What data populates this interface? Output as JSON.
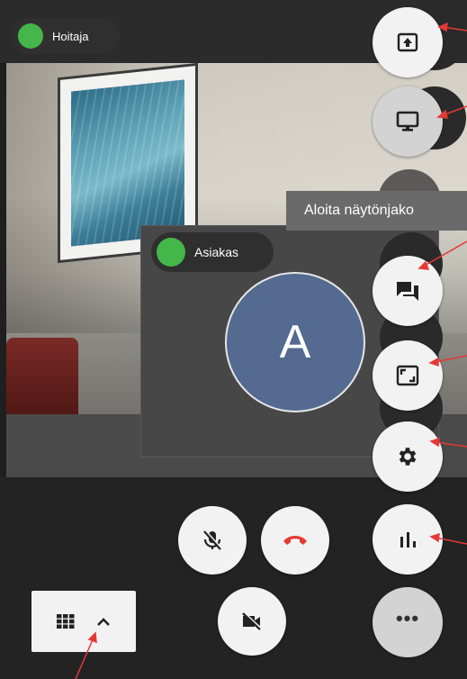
{
  "participants": {
    "remote_name": "Hoitaja",
    "local_name": "Asiakas",
    "local_avatar_initial": "A"
  },
  "status_colors": {
    "presence": "#45b649",
    "hangup": "#e53935"
  },
  "tooltip": {
    "text": "Aloita näytönjako"
  },
  "side_buttons": [
    {
      "icon": "share-screen-icon"
    },
    {
      "icon": "monitor-icon"
    },
    {
      "icon": "chat-icon"
    },
    {
      "icon": "fullscreen-icon"
    },
    {
      "icon": "gear-icon"
    },
    {
      "icon": "stats-icon"
    },
    {
      "icon": "more-icon",
      "label": "•••"
    }
  ],
  "call_controls": [
    {
      "icon": "mic-off-icon"
    },
    {
      "icon": "hangup-icon"
    },
    {
      "icon": "camera-off-icon"
    }
  ],
  "view_toggle": {
    "icons": [
      "grid-icon",
      "chevron-up-icon"
    ]
  }
}
